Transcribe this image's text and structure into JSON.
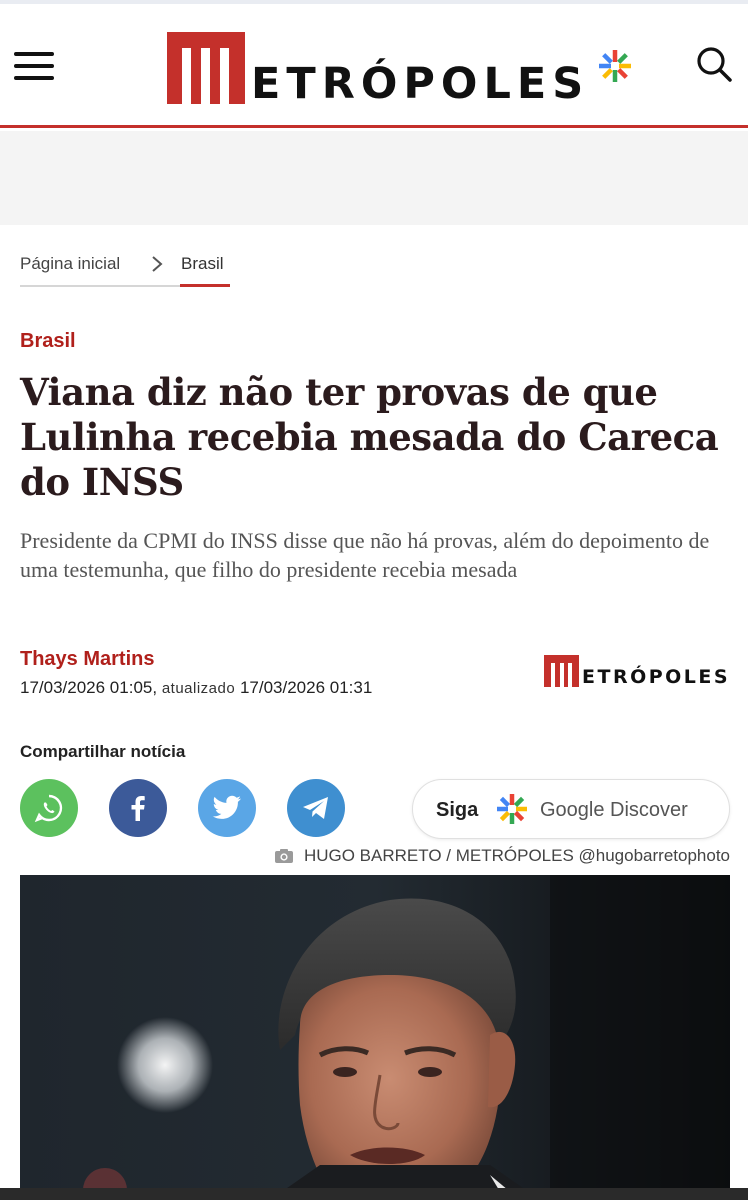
{
  "header": {
    "logo_text": "ETRÓPOLES",
    "logo_letter": "M",
    "brand_color": "#c4302b",
    "menu_icon": "hamburger-menu-icon",
    "search_icon": "search-icon"
  },
  "breadcrumb": {
    "home": "Página inicial",
    "section": "Brasil"
  },
  "article": {
    "kicker": "Brasil",
    "headline": "Viana diz não ter provas de que Lulinha recebia mesada do Careca do INSS",
    "subtitle": "Presidente da CPMI do INSS disse que não há provas, além do depoimento de uma testemunha, que filho do presidente recebia mesada",
    "author": "Thays Martins",
    "published": "17/03/2026 01:05,",
    "updated_label": "atualizado",
    "updated": "17/03/2026 01:31"
  },
  "share": {
    "label": "Compartilhar notícia",
    "buttons": [
      "whatsapp",
      "facebook",
      "twitter",
      "telegram"
    ],
    "discover_follow": "Siga",
    "discover_name": "Google Discover"
  },
  "photo": {
    "credit": "HUGO BARRETO / METRÓPOLES @hugobarretophoto",
    "credit_icon": "camera-icon"
  },
  "colors": {
    "accent": "#c4302b",
    "kicker": "#b0201b",
    "headline": "#2b1b1d",
    "whatsapp": "#5cc15e",
    "facebook": "#3c5a99",
    "twitter": "#5aa6e6",
    "telegram": "#3f8fd0"
  }
}
